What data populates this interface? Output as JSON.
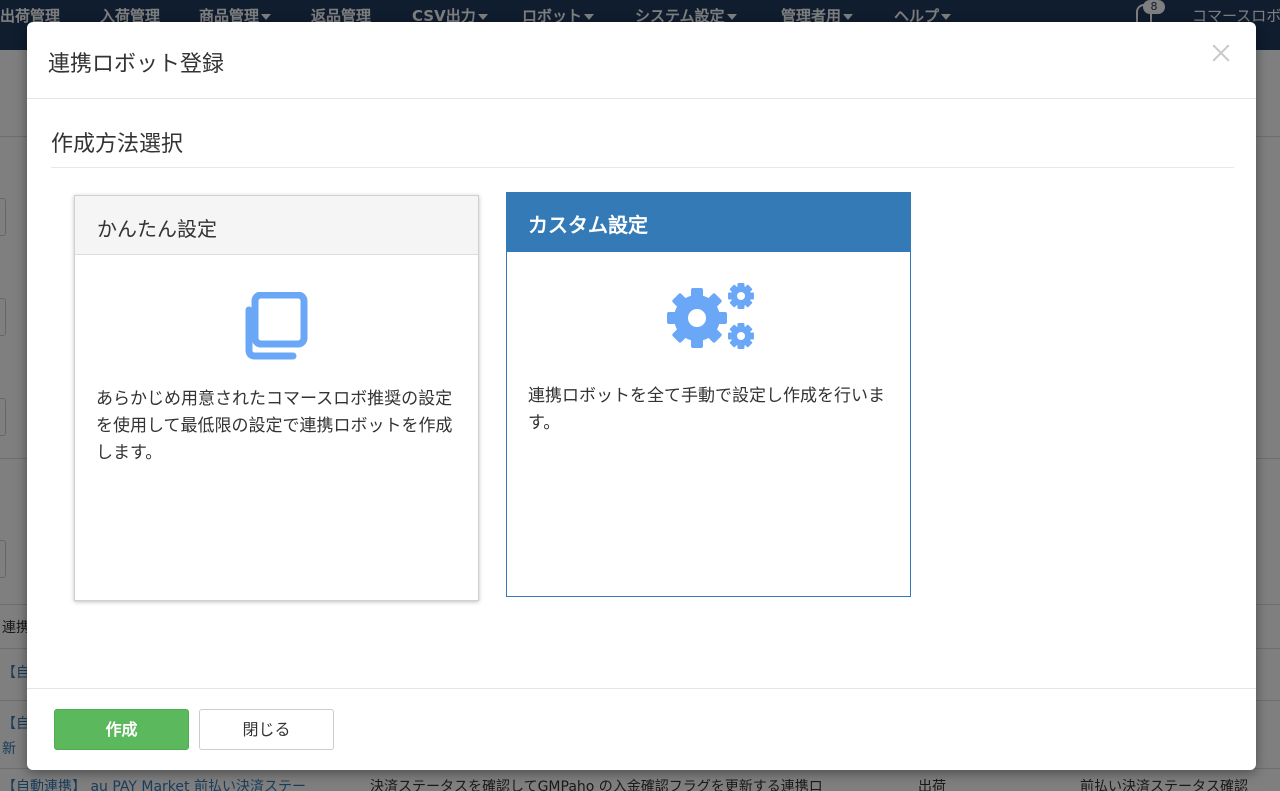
{
  "nav": {
    "items": [
      {
        "label": "出荷管理",
        "dropdown": false
      },
      {
        "label": "入荷管理",
        "dropdown": false
      },
      {
        "label": "商品管理",
        "dropdown": true
      },
      {
        "label": "返品管理",
        "dropdown": false
      },
      {
        "label": "CSV出力",
        "dropdown": true
      },
      {
        "label": "ロボット",
        "dropdown": true
      },
      {
        "label": "システム設定",
        "dropdown": true
      },
      {
        "label": "管理者用",
        "dropdown": true
      },
      {
        "label": "ヘルプ",
        "dropdown": true
      }
    ],
    "notification_count": "8",
    "user_label": "コマースロボ"
  },
  "background": {
    "rows": [
      "連携",
      "【自",
      "【自",
      "新",
      "【自動連携】 au PAY Market 前払い決済ステー",
      "決済ステータスを確認してGMPaho の入金確認フラグを更新する連携ロ",
      "出荷",
      "前払い決済ステータス確認"
    ]
  },
  "modal": {
    "title": "連携ロボット登録",
    "section_title": "作成方法選択",
    "cards": {
      "easy": {
        "heading": "かんたん設定",
        "icon": "copy-icon",
        "description": "あらかじめ用意されたコマースロボ推奨の設定を使用して最低限の設定で連携ロボットを作成します。",
        "selected": false
      },
      "custom": {
        "heading": "カスタム設定",
        "icon": "cogs-icon",
        "description": "連携ロボットを全て手動で設定し作成を行います。",
        "selected": true
      }
    },
    "footer": {
      "create_label": "作成",
      "close_label": "閉じる"
    }
  },
  "colors": {
    "primary": "#337ab7",
    "success": "#5cb85c",
    "icon_blue": "#6aa8f7",
    "nav_bg": "#1f3a5f"
  }
}
